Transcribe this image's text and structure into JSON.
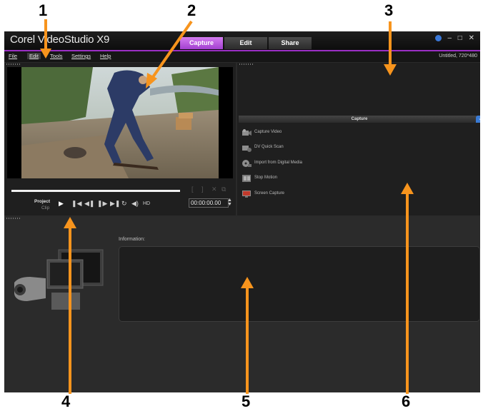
{
  "window": {
    "app_title": "Corel VideoStudio X9",
    "tabs": [
      {
        "label": "Capture",
        "active": true
      },
      {
        "label": "Edit",
        "active": false
      },
      {
        "label": "Share",
        "active": false
      }
    ],
    "window_buttons": [
      "globe-icon",
      "minimize-icon",
      "maximize-icon",
      "close-icon"
    ]
  },
  "menu": {
    "items": [
      "File",
      "Edit",
      "Tools",
      "Settings",
      "Help"
    ],
    "selected": "Edit",
    "project_info": "Untitled, 720*480"
  },
  "player": {
    "mode_project": "Project",
    "mode_clip": "Clip",
    "timecode": "00:00:00.00",
    "hd_label": "HD",
    "controls": [
      "play-icon",
      "home-icon",
      "previous-frame-icon",
      "next-frame-icon",
      "end-icon",
      "repeat-icon",
      "volume-icon"
    ]
  },
  "capture_panel": {
    "title": "Capture",
    "options": [
      {
        "label": "Capture Video",
        "icon": "video-camera-icon"
      },
      {
        "label": "DV Quick Scan",
        "icon": "dv-scan-icon"
      },
      {
        "label": "Import from Digital Media",
        "icon": "digital-media-icon"
      },
      {
        "label": "Stop Motion",
        "icon": "stop-motion-icon"
      },
      {
        "label": "Screen Capture",
        "icon": "screen-capture-icon"
      }
    ]
  },
  "information": {
    "label": "Information:"
  },
  "callouts": [
    "1",
    "2",
    "3",
    "4",
    "5",
    "6"
  ],
  "colors": {
    "accent": "#9b2fc5",
    "active_tab": "#b650dc",
    "arrow": "#f7941d",
    "background": "#2a2a2a"
  }
}
